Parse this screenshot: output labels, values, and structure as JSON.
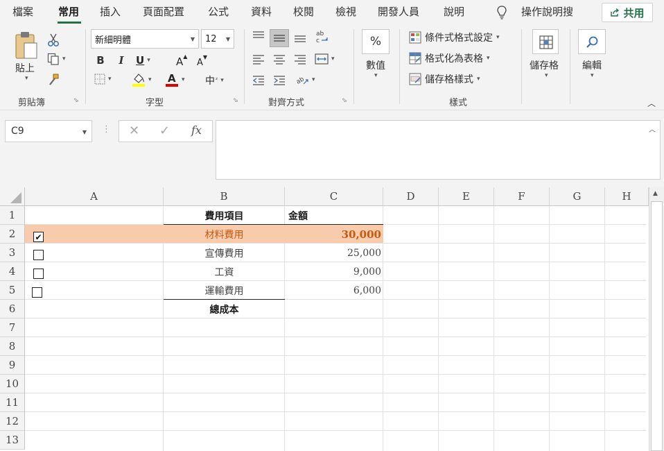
{
  "tabs": [
    {
      "label": "檔案",
      "active": false
    },
    {
      "label": "常用",
      "active": true
    },
    {
      "label": "插入",
      "active": false
    },
    {
      "label": "頁面配置",
      "active": false
    },
    {
      "label": "公式",
      "active": false
    },
    {
      "label": "資料",
      "active": false
    },
    {
      "label": "校閱",
      "active": false
    },
    {
      "label": "檢視",
      "active": false
    },
    {
      "label": "開發人員",
      "active": false
    },
    {
      "label": "說明",
      "active": false
    }
  ],
  "tell_me": "操作說明搜",
  "share_label": "共用",
  "ribbon": {
    "clipboard": {
      "paste_label": "貼上",
      "group_label": "剪貼簿"
    },
    "font": {
      "font_name": "新細明體",
      "font_size": "12",
      "group_label": "字型",
      "bold": "B",
      "italic": "I",
      "underline": "U",
      "grow": "A",
      "shrink": "A",
      "phonetic": "中",
      "font_color_letter": "A"
    },
    "alignment": {
      "group_label": "對齊方式"
    },
    "number": {
      "symbol": "%",
      "label": "數值"
    },
    "styles": {
      "conditional": "條件式格式設定",
      "format_table": "格式化為表格",
      "cell_styles": "儲存格樣式",
      "group_label": "樣式"
    },
    "cells": {
      "label": "儲存格"
    },
    "editing": {
      "label": "編輯"
    }
  },
  "name_box": "C9",
  "fx_label": "fx",
  "columns": [
    "A",
    "B",
    "C",
    "D",
    "E",
    "F",
    "G",
    "H"
  ],
  "rows": [
    "1",
    "2",
    "3",
    "4",
    "5",
    "6",
    "7",
    "8",
    "9",
    "10",
    "11",
    "12",
    "13"
  ],
  "sheet": {
    "header_item": "費用項目",
    "header_amount": "金額",
    "items": [
      {
        "checked": true,
        "name": "材料費用",
        "amount": "30,000"
      },
      {
        "checked": false,
        "name": "宣傳費用",
        "amount": "25,000"
      },
      {
        "checked": false,
        "name": "工資",
        "amount": "9,000"
      },
      {
        "checked": false,
        "name": "運輸費用",
        "amount": "6,000"
      }
    ],
    "total_label": "總成本",
    "highlight_fill": "#f8cbad",
    "highlight_text": "#c55a11"
  },
  "accent_color": "#217346"
}
